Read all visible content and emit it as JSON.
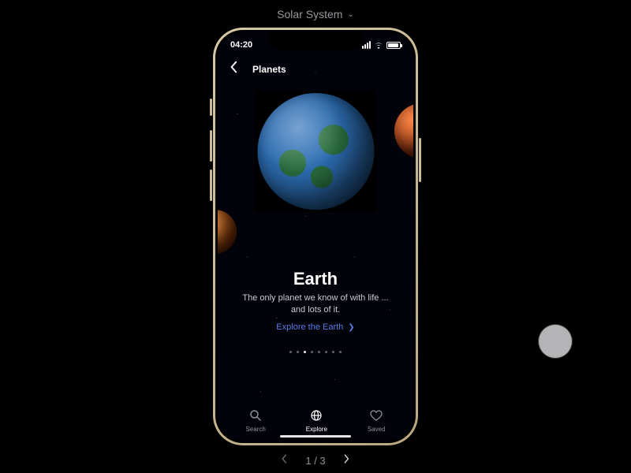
{
  "dropdown": {
    "label": "Solar System"
  },
  "status": {
    "time": "04:20"
  },
  "header": {
    "title": "Planets"
  },
  "main": {
    "name": "Earth",
    "description": "The only planet we know of with life ... and lots of it.",
    "cta": "Explore the Earth",
    "dot_count": 8,
    "active_dot_index": 2
  },
  "tabs": {
    "search": "Search",
    "explore": "Explore",
    "saved": "Saved"
  },
  "pager": {
    "label": "1 / 3"
  }
}
